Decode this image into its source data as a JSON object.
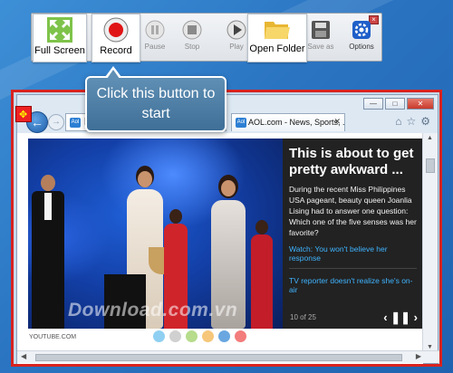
{
  "toolbar": {
    "buttons": [
      {
        "label": "Full Screen",
        "icon": "fullscreen-icon",
        "highlighted": true
      },
      {
        "label": "Record",
        "icon": "record-icon",
        "highlighted": true
      },
      {
        "label": "Pause",
        "icon": "pause-icon",
        "highlighted": false
      },
      {
        "label": "Stop",
        "icon": "stop-icon",
        "highlighted": false
      },
      {
        "label": "Play",
        "icon": "play-icon",
        "highlighted": false
      },
      {
        "label": "Open Folder",
        "icon": "folder-icon",
        "highlighted": true
      },
      {
        "label": "Save as",
        "icon": "save-icon",
        "highlighted": false
      },
      {
        "label": "Options",
        "icon": "gear-icon",
        "highlighted": false
      }
    ]
  },
  "tooltip": {
    "text": "Click this button to start"
  },
  "browser": {
    "address_text": "h",
    "tab_title": "AOL.com - News, Sports, ...",
    "article": {
      "headline": "This is about to get pretty awkward ...",
      "body": "During the recent Miss Philippines USA pageant, beauty queen Joanlia Lising had to answer one question: Which one of the five senses was her favorite?",
      "link_primary": "Watch: You won't believe her response",
      "link_secondary": "TV reporter doesn't realize she's on-air",
      "counter": "10 of 25",
      "source": "YOUTUBE.COM"
    },
    "watermark": "Download.com.vn",
    "pager_dots": [
      "#8fd0f2",
      "#d0d0d0",
      "#b6dc8c",
      "#f6c77a",
      "#6aa7e0",
      "#f37c7c"
    ]
  },
  "colors": {
    "record_frame": "#d8231f",
    "accent": "#3fb4ff"
  }
}
